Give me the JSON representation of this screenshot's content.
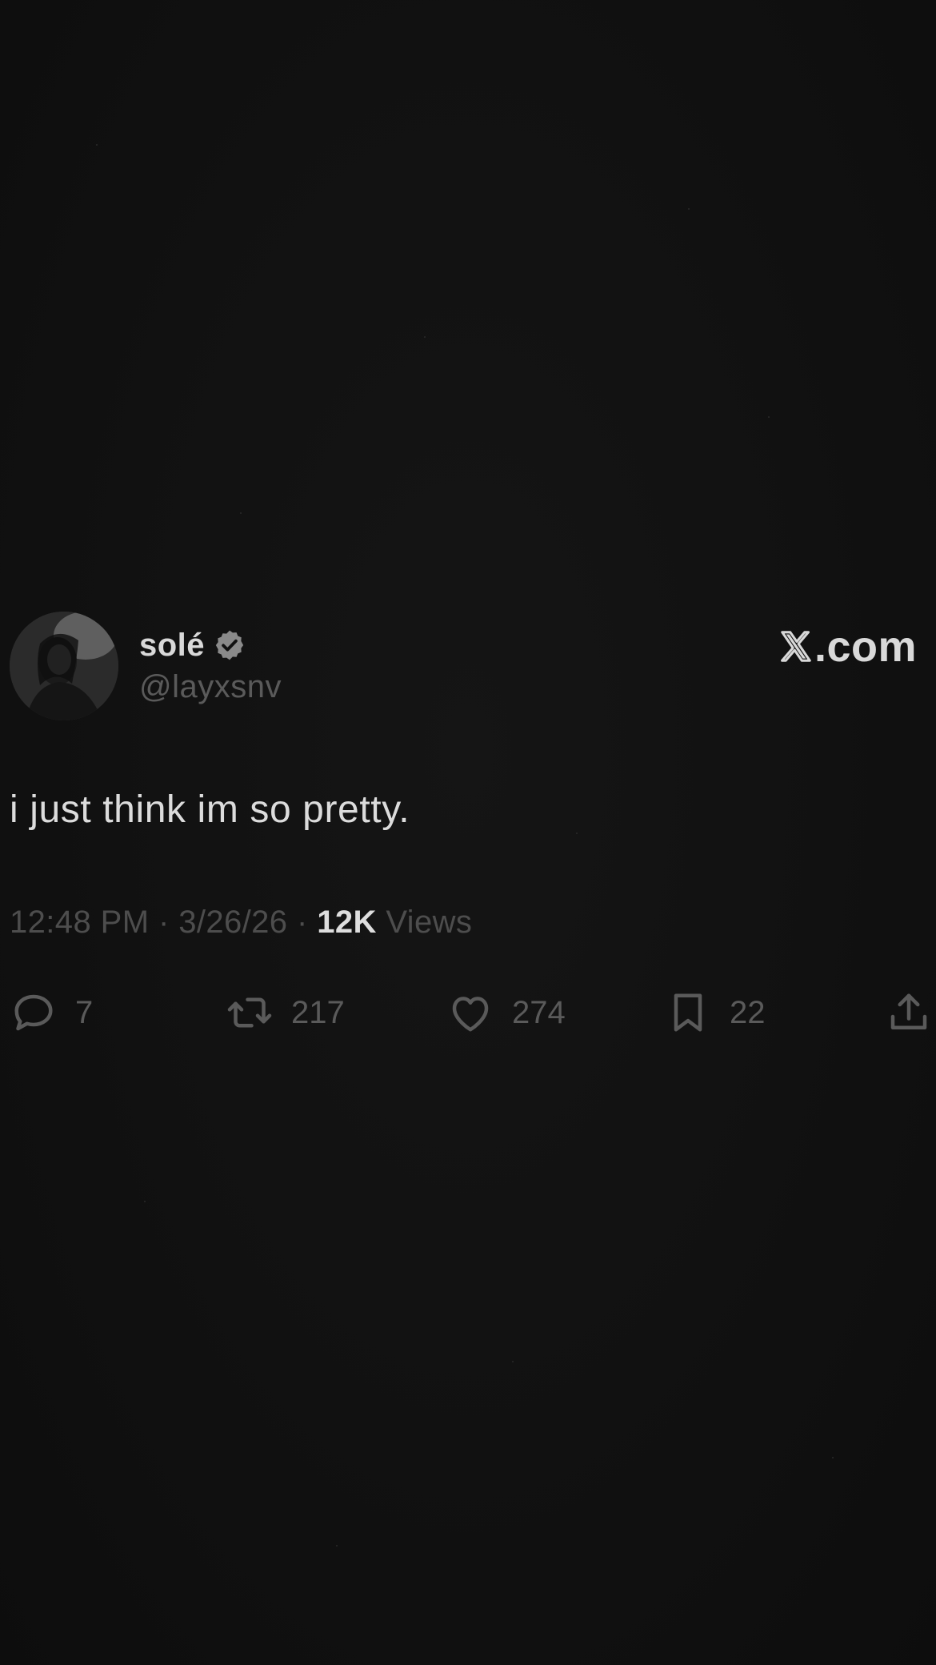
{
  "tweet": {
    "author": {
      "display_name": "solé",
      "handle": "@layxsnv",
      "verified": true
    },
    "brand": "X.com",
    "brand_suffix": ".com",
    "text": "i just think im so pretty.",
    "time": "12:48 PM",
    "date": "3/26/26",
    "separator": "·",
    "views_count": "12K",
    "views_label": "Views",
    "actions": {
      "replies": "7",
      "reposts": "217",
      "likes": "274",
      "bookmarks": "22"
    }
  },
  "icons": [
    "verified-icon",
    "x-logo-icon",
    "reply-icon",
    "repost-icon",
    "like-icon",
    "bookmark-icon",
    "share-icon"
  ],
  "colors": {
    "background": "#111111",
    "primary_text": "#dcdcdc",
    "secondary_text": "#5a5a5a",
    "verified_badge": "#8a8a8a"
  }
}
